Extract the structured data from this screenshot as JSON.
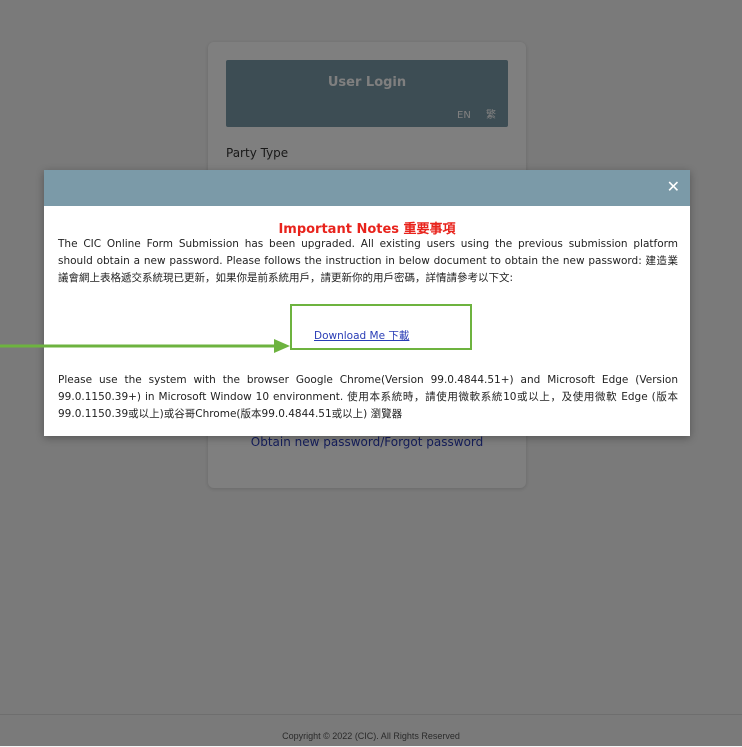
{
  "login": {
    "title": "User Login",
    "lang_en": "EN",
    "lang_zh": "繁",
    "party_type_label": "Party Type",
    "forgot_link": "Obtain new password/Forgot password"
  },
  "footer": {
    "copyright": "Copyright © 2022 (CIC). All Rights Reserved"
  },
  "modal": {
    "close_icon": "close-icon",
    "title": "Important Notes 重要事項",
    "paragraph1": "The CIC Online Form Submission has been upgraded. All existing users using the previous submission platform should obtain a new password. Please follows the instruction in below document to obtain the new password: 建造業議會網上表格遞交系統現已更新，如果你是前系統用戶，請更新你的用戶密碼，詳情請參考以下文:",
    "download_link": "Download Me 下載",
    "paragraph2": "Please use the system with the browser Google Chrome(Version 99.0.4844.51+) and Microsoft Edge (Version 99.0.1150.39+) in Microsoft Window 10 environment. 使用本系統時，請使用微軟系統10或以上，及使用微軟 Edge (版本99.0.1150.39或以上)或谷哥Chrome(版本99.0.4844.51或以上) 瀏覽器"
  },
  "colors": {
    "header": "#7b9aa8",
    "title_red": "#e8231c",
    "link_blue": "#2a3db6",
    "annotation_green": "#6db33f"
  }
}
